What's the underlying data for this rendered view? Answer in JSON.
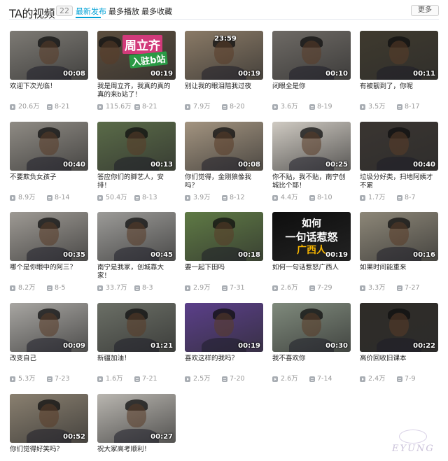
{
  "header": {
    "title": "TA的视频",
    "count": "22",
    "tabs": [
      {
        "label": "最新发布",
        "active": true
      },
      {
        "label": "最多播放",
        "active": false
      },
      {
        "label": "最多收藏",
        "active": false
      }
    ],
    "more_label": "更多"
  },
  "colors": {
    "accent": "#00a1d6",
    "meta": "#999999",
    "title": "#222222"
  },
  "videos": [
    {
      "title": "欢迎下次光临！",
      "duration": "00:08",
      "plays": "20.6万",
      "date": "8-21",
      "thumb_bg": "#7d7a74"
    },
    {
      "title": "我是周立齐，我真的真的真的来b站了！",
      "duration": "00:19",
      "plays": "115.6万",
      "date": "8-21",
      "thumb_bg": "#5c4e3e",
      "overlay": [
        "周立齐",
        "入驻b站"
      ]
    },
    {
      "title": "别让我的眼泪陪我过夜",
      "duration": "00:19",
      "plays": "7.9万",
      "date": "8-20",
      "thumb_bg": "#8a7a66",
      "top_text": "23:59"
    },
    {
      "title": "闭眼全是你",
      "duration": "00:10",
      "plays": "3.6万",
      "date": "8-19",
      "thumb_bg": "#6e6a65"
    },
    {
      "title": "有被靓到了，你呢",
      "duration": "00:11",
      "plays": "3.5万",
      "date": "8-17",
      "thumb_bg": "#3f3a2e"
    },
    {
      "title": "不要欺负女孩子",
      "duration": "00:40",
      "plays": "8.9万",
      "date": "8-14",
      "thumb_bg": "#8f8b84"
    },
    {
      "title": "答应你们的脚艺人，安排！",
      "duration": "00:13",
      "plays": "50.4万",
      "date": "8-13",
      "thumb_bg": "#5a6b48"
    },
    {
      "title": "你们觉得，金刚狼像我吗？",
      "duration": "00:08",
      "plays": "3.9万",
      "date": "8-12",
      "thumb_bg": "#a39480"
    },
    {
      "title": "你不贴，我不贴，南宁创城比个耶！",
      "duration": "00:25",
      "plays": "4.4万",
      "date": "8-10",
      "thumb_bg": "#cfcac2"
    },
    {
      "title": "垃圾分好类，扫地阿姨才不累",
      "duration": "00:40",
      "plays": "1.7万",
      "date": "8-7",
      "thumb_bg": "#3a3531"
    },
    {
      "title": "哪个是你眼中的阿三？",
      "duration": "00:35",
      "plays": "8.2万",
      "date": "8-5",
      "thumb_bg": "#9e9a94"
    },
    {
      "title": "南宁是我家，创城靠大家！",
      "duration": "00:45",
      "plays": "33.7万",
      "date": "8-3",
      "thumb_bg": "#9c9b98"
    },
    {
      "title": "要一起下田吗",
      "duration": "00:18",
      "plays": "2.9万",
      "date": "7-31",
      "thumb_bg": "#5f7a45"
    },
    {
      "title": "如何一句话惹怒广西人",
      "duration": "00:19",
      "plays": "2.6万",
      "date": "7-29",
      "thumb_bg": "#0e0e0e",
      "overlay": [
        "如何",
        "一句话惹怒",
        "广西人"
      ]
    },
    {
      "title": "如果时间能重来",
      "duration": "00:16",
      "plays": "3.3万",
      "date": "7-27",
      "thumb_bg": "#8d8778"
    },
    {
      "title": "改变自己",
      "duration": "00:09",
      "plays": "5.3万",
      "date": "7-23",
      "thumb_bg": "#a8a6a2"
    },
    {
      "title": "新疆加油！",
      "duration": "01:21",
      "plays": "1.6万",
      "date": "7-21",
      "thumb_bg": "#6b6f66"
    },
    {
      "title": "喜欢这样的我吗？",
      "duration": "00:19",
      "plays": "2.5万",
      "date": "7-20",
      "thumb_bg": "#5b3f8a"
    },
    {
      "title": "我不喜欢你",
      "duration": "00:30",
      "plays": "2.6万",
      "date": "7-14",
      "thumb_bg": "#7f8a7c"
    },
    {
      "title": "高价回收旧课本",
      "duration": "00:22",
      "plays": "2.4万",
      "date": "7-9",
      "thumb_bg": "#2f2c28"
    },
    {
      "title": "你们觉得好笑吗？",
      "duration": "00:52",
      "plays": "",
      "date": "",
      "thumb_bg": "#8a8070"
    },
    {
      "title": "祝大家高考顺利！",
      "duration": "00:27",
      "plays": "",
      "date": "",
      "thumb_bg": "#b9b6b0"
    }
  ],
  "watermark": "EYUNG"
}
